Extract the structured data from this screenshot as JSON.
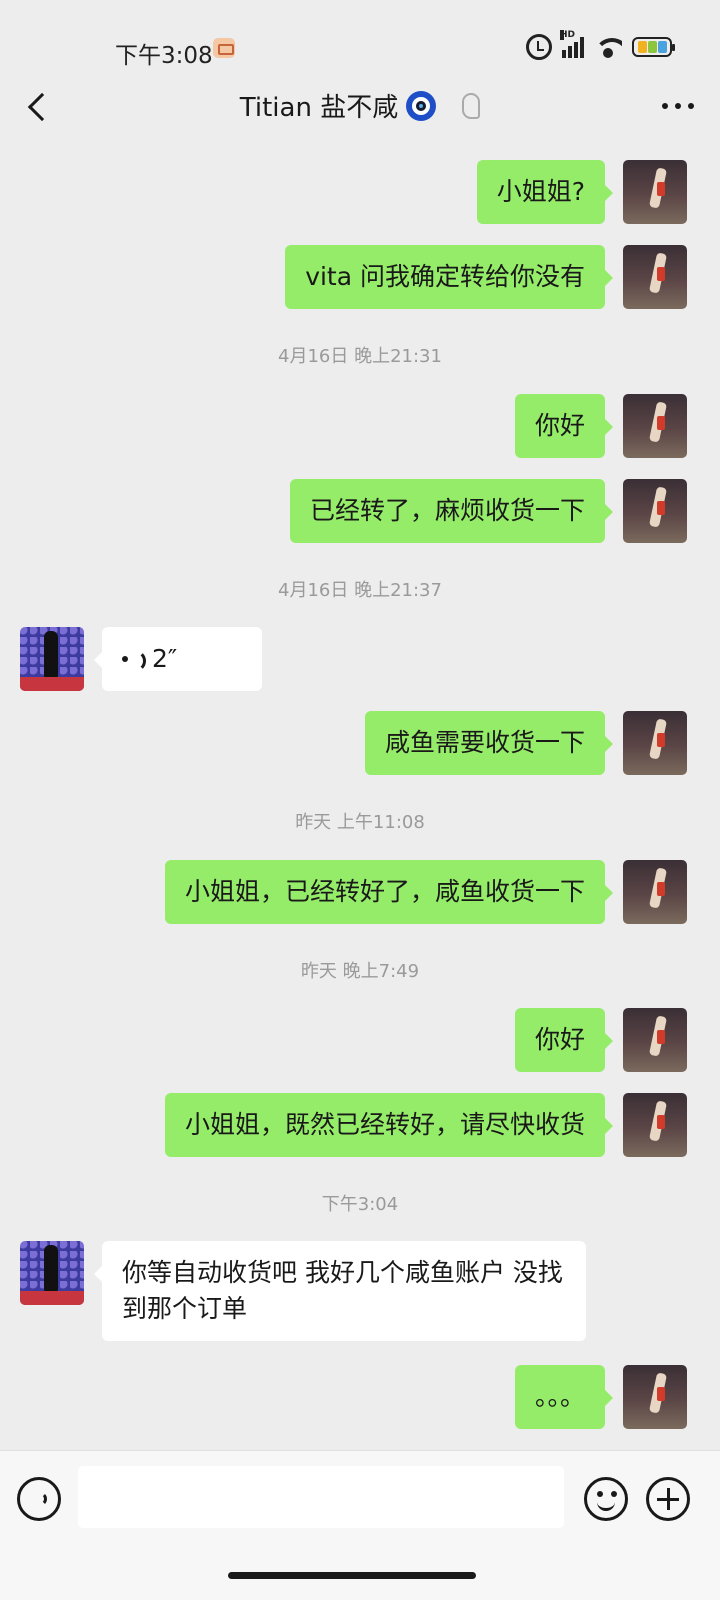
{
  "status_bar": {
    "time": "下午3:08",
    "network_badge": "HD",
    "battery_label": "100"
  },
  "header": {
    "title": "Titian 盐不咸",
    "title_emoji_icon": "evil-eye-icon",
    "mute_icon": "ear-icon"
  },
  "messages": [
    {
      "type": "text",
      "from": "me",
      "text": "小姐姐?"
    },
    {
      "type": "text",
      "from": "me",
      "text": "vita 问我确定转给你没有"
    },
    {
      "type": "time",
      "text": "4月16日 晚上21:31"
    },
    {
      "type": "text",
      "from": "me",
      "text": "你好"
    },
    {
      "type": "text",
      "from": "me",
      "text": "已经转了，麻烦收货一下"
    },
    {
      "type": "time",
      "text": "4月16日 晚上21:37"
    },
    {
      "type": "voice",
      "from": "other",
      "duration": "2″"
    },
    {
      "type": "text",
      "from": "me",
      "text": "咸鱼需要收货一下"
    },
    {
      "type": "time",
      "text": "昨天 上午11:08"
    },
    {
      "type": "text",
      "from": "me",
      "text": "小姐姐，已经转好了，咸鱼收货一下"
    },
    {
      "type": "time",
      "text": "昨天 晚上7:49"
    },
    {
      "type": "text",
      "from": "me",
      "text": "你好"
    },
    {
      "type": "text",
      "from": "me",
      "text": "小姐姐，既然已经转好，请尽快收货"
    },
    {
      "type": "time",
      "text": "下午3:04"
    },
    {
      "type": "text",
      "from": "other",
      "text": "你等自动收货吧 我好几个咸鱼账户 没找到那个订单"
    },
    {
      "type": "text",
      "from": "me",
      "text": "。。。"
    }
  ],
  "input_bar": {
    "value": "",
    "voice_icon": "voice-mode-icon",
    "emoji_icon": "emoji-icon",
    "plus_icon": "plus-icon"
  },
  "colors": {
    "chat_background": "#ededed",
    "my_bubble": "#95ec69",
    "other_bubble": "#ffffff",
    "timestamp_text": "#9a9a9a"
  }
}
